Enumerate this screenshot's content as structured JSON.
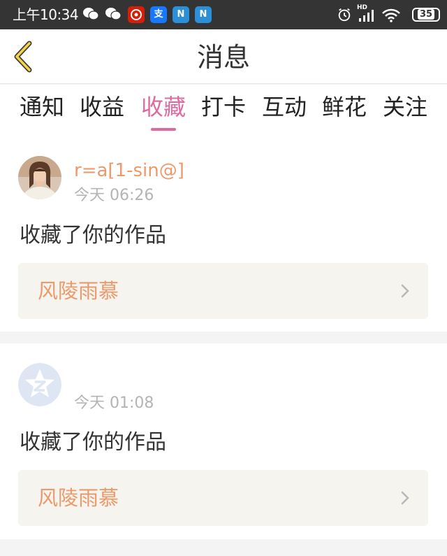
{
  "status_bar": {
    "time": "上午10:34",
    "notification_icons": [
      "wechat-icon",
      "wechat-icon",
      "taobao-icon",
      "alipay-icon",
      "nb-icon",
      "nb-icon"
    ],
    "alipay_glyph": "支",
    "nb_glyph": "N",
    "battery": "35",
    "network": "HD"
  },
  "header": {
    "title": "消息",
    "back_icon": "chevron-left-icon"
  },
  "tabs": {
    "items": [
      "通知",
      "收益",
      "收藏",
      "打卡",
      "互动",
      "鲜花",
      "关注"
    ],
    "active_index": 2,
    "active_color": "#e06aa0"
  },
  "messages": [
    {
      "username": "r=a[1-sin@]",
      "time": "今天 06:26",
      "action": "收藏了你的作品",
      "work_title": "风陵雨慕",
      "avatar": "user-photo-avatar"
    },
    {
      "username": "",
      "time": "今天 01:08",
      "action": "收藏了你的作品",
      "work_title": "风陵雨慕",
      "avatar": "default-avatar-icon"
    }
  ],
  "colors": {
    "accent": "#eb9a6c",
    "tab_active": "#e06aa0",
    "status_bar_bg": "#343434",
    "work_box_bg": "#f5f4ee"
  }
}
